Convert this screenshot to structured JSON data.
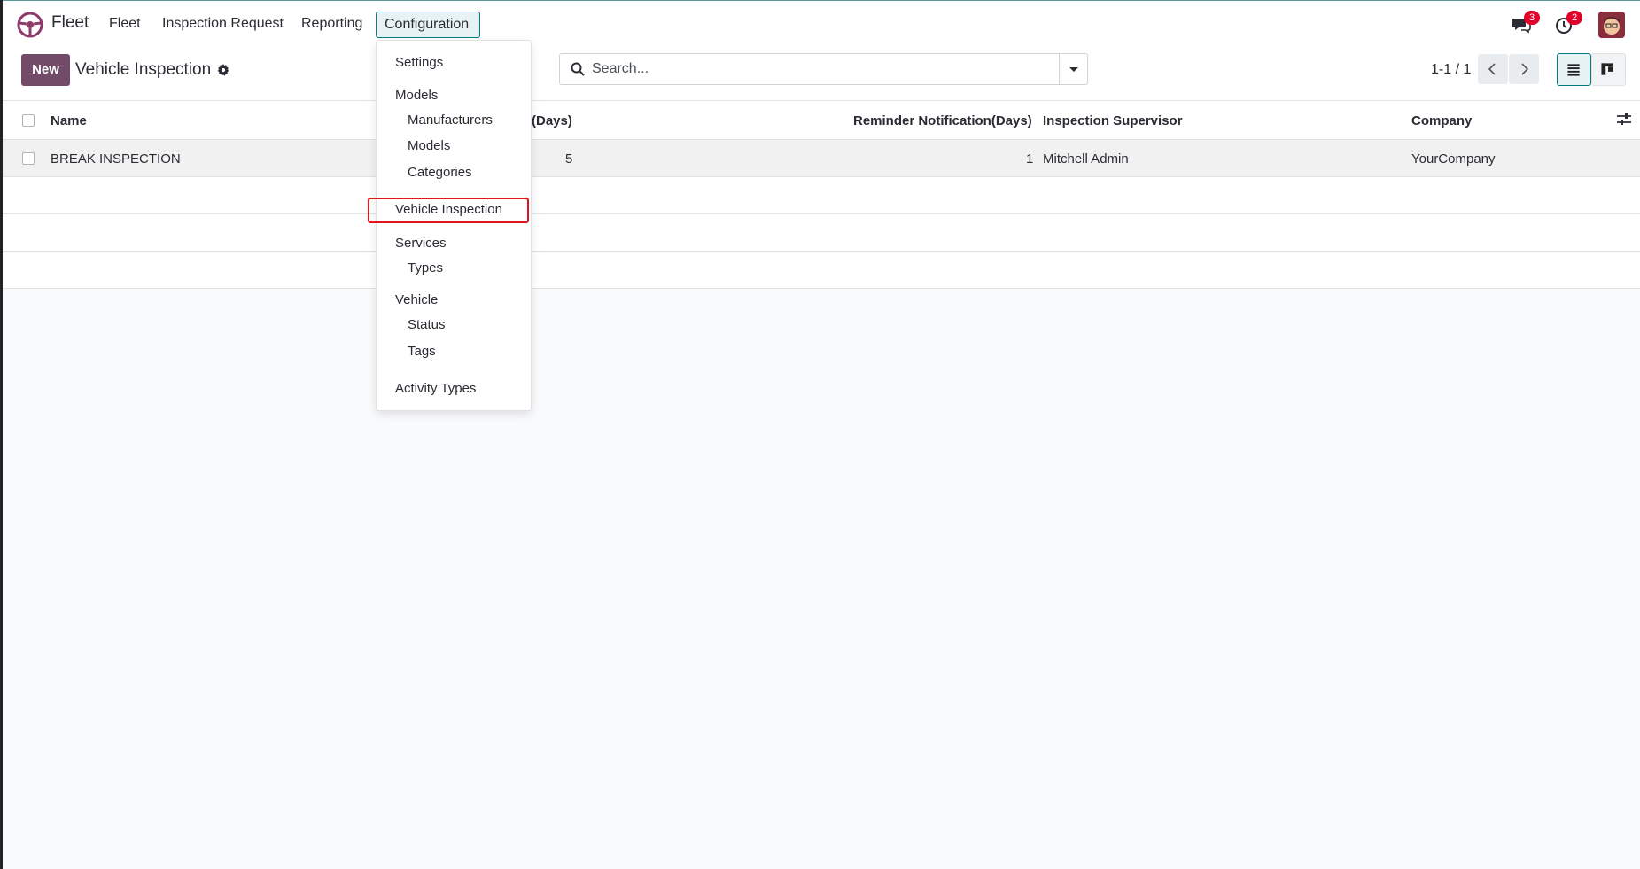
{
  "navbar": {
    "app_name": "Fleet",
    "menu": [
      "Fleet",
      "Inspection Request",
      "Reporting",
      "Configuration"
    ],
    "messages_badge": "3",
    "activities_badge": "2",
    "icons": [
      "steering-wheel-logo-icon",
      "chat-icon",
      "clock-icon",
      "user-avatar"
    ],
    "accent": "#714b67",
    "active_menu_border": "#017e84"
  },
  "control": {
    "new_label": "New",
    "title": "Vehicle Inspection",
    "search_placeholder": "Search...",
    "pager": "1-1 / 1"
  },
  "dropdown": {
    "items": [
      {
        "label": "Settings",
        "level": "header"
      },
      {
        "label": "Models",
        "level": "header"
      },
      {
        "label": "Manufacturers",
        "level": "sub"
      },
      {
        "label": "Models",
        "level": "sub"
      },
      {
        "label": "Categories",
        "level": "sub"
      },
      {
        "label": "Vehicle Inspection",
        "level": "header",
        "highlighted": true
      },
      {
        "label": "Services",
        "level": "header"
      },
      {
        "label": "Types",
        "level": "sub"
      },
      {
        "label": "Vehicle",
        "level": "header"
      },
      {
        "label": "Status",
        "level": "sub"
      },
      {
        "label": "Tags",
        "level": "sub"
      },
      {
        "label": "Activity Types",
        "level": "header"
      }
    ],
    "highlight_color": "#e3141b"
  },
  "table": {
    "columns": [
      "Name",
      "(Days)",
      "Reminder Notification(Days)",
      "Inspection Supervisor",
      "Company"
    ],
    "rows": [
      {
        "name": "BREAK INSPECTION",
        "days": "5",
        "reminder": "1",
        "supervisor": "Mitchell Admin",
        "company": "YourCompany"
      }
    ]
  }
}
